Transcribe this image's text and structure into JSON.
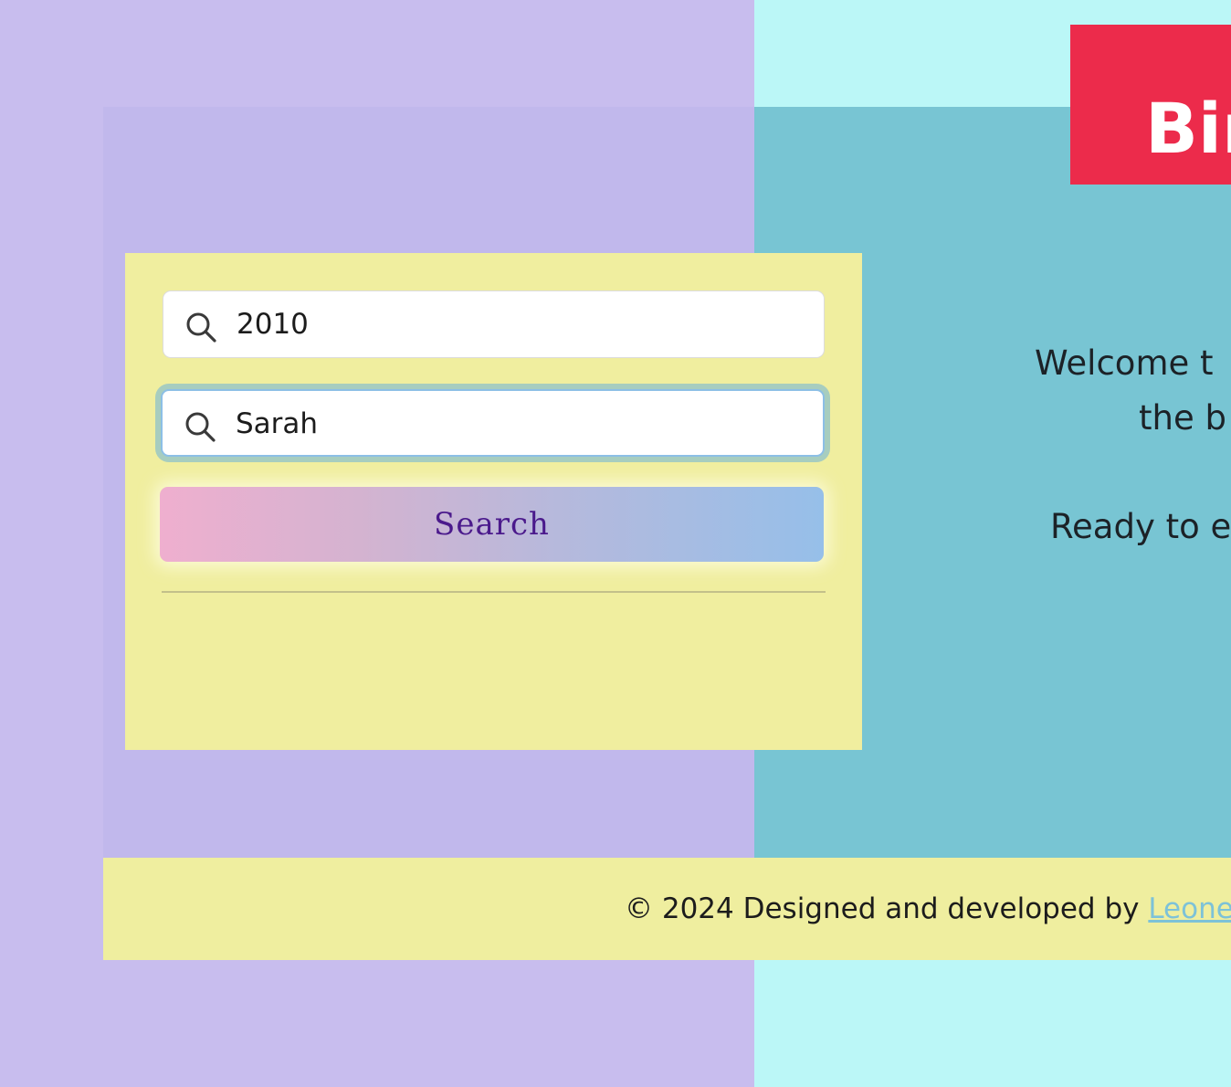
{
  "header": {
    "title": "Bir"
  },
  "search": {
    "field1_value": "2010",
    "field2_value": "Sarah",
    "button_label": "Search"
  },
  "intro": {
    "welcome_line1": "Welcome t",
    "welcome_line2": "the b",
    "ready": "Ready to e"
  },
  "footer": {
    "text": "© 2024 Designed and developed by ",
    "author_link": "Leone"
  },
  "colors": {
    "left_bg": "#c8bdee",
    "right_bg": "#bbf7f7",
    "main_left": "#c1b8ec",
    "main_right": "#78c5d3",
    "title_block": "#ec2b4b",
    "panel": "#f0ee9f",
    "button_text": "#4b1a8c"
  },
  "icons": [
    "search-icon",
    "search-icon"
  ]
}
